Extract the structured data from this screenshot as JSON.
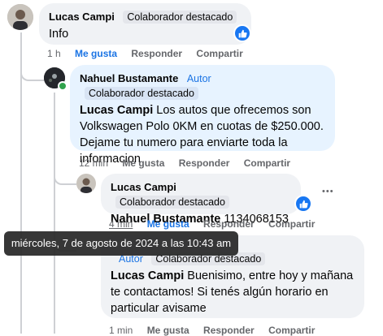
{
  "comments": [
    {
      "author": "Lucas Campi",
      "badges": [
        "Colaborador destacado"
      ],
      "mention": "",
      "text": "Info",
      "time": "1 h",
      "actions": [
        "Me gusta",
        "Responder",
        "Compartir"
      ]
    },
    {
      "author": "Nahuel Bustamante",
      "role": "Autor",
      "badges": [
        "Colaborador destacado"
      ],
      "mention": "Lucas Campi",
      "text": " Los autos que ofrecemos son Volkswagen Polo 0KM en cuotas de $250.000. Dejame tu numero para enviarte toda la informacion",
      "time": "12 min",
      "actions": [
        "Me gusta",
        "Responder",
        "Compartir"
      ]
    },
    {
      "author": "Lucas Campi",
      "badges": [
        "Colaborador destacado"
      ],
      "mention": "Nahuel Bustamante",
      "text": " 1134068153",
      "time": "4 min",
      "actions": [
        "Me gusta",
        "Responder",
        "Compartir"
      ]
    },
    {
      "author": "Nahuel Bustamante",
      "role": "Autor",
      "badges": [
        "Colaborador destacado"
      ],
      "mention": "Lucas Campi",
      "text": " Buenisimo, entre hoy y mañana te contactamos! Si tenés algún horario en particular avisame",
      "time": "1 min",
      "actions": [
        "Me gusta",
        "Responder",
        "Compartir"
      ]
    }
  ],
  "tooltip": "miércoles, 7 de agosto de 2024 a las 10:43 am",
  "more_menu_glyph": "•••",
  "colors": {
    "accent": "#1b74e4",
    "bubble": "#f0f2f5",
    "bubble_blue": "#e7f3ff",
    "online": "#31a24c"
  },
  "icons": [
    "like-icon",
    "more-options-icon"
  ]
}
